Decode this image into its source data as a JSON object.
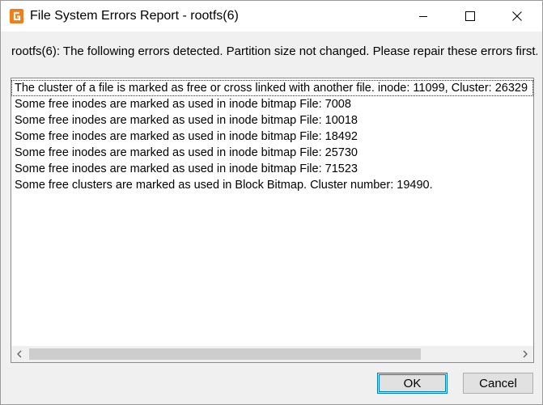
{
  "window": {
    "title": "File System Errors Report - rootfs(6)"
  },
  "message": "rootfs(6): The following errors detected. Partition size not changed. Please repair these errors first.",
  "errors": [
    "The cluster of a file is marked as free or cross linked with another file. inode: 11099, Cluster: 26329",
    "Some free inodes are marked as used in inode bitmap File: 7008",
    "Some free inodes are marked as used in inode bitmap File: 10018",
    "Some free inodes are marked as used in inode bitmap File: 18492",
    "Some free inodes are marked as used in inode bitmap File: 25730",
    "Some free inodes are marked as used in inode bitmap File: 71523",
    "Some free clusters are marked as used in Block Bitmap. Cluster number: 19490."
  ],
  "buttons": {
    "ok": "OK",
    "cancel": "Cancel"
  },
  "colors": {
    "app_icon": "#f07c1a",
    "focus_border": "#0078d7",
    "scroll_thumb": "#cdcdcd"
  },
  "icons": {
    "app": "partition-tool-icon",
    "minimize": "minimize-icon",
    "maximize": "maximize-icon",
    "close": "close-icon",
    "scroll_left": "chevron-left-icon",
    "scroll_right": "chevron-right-icon"
  }
}
